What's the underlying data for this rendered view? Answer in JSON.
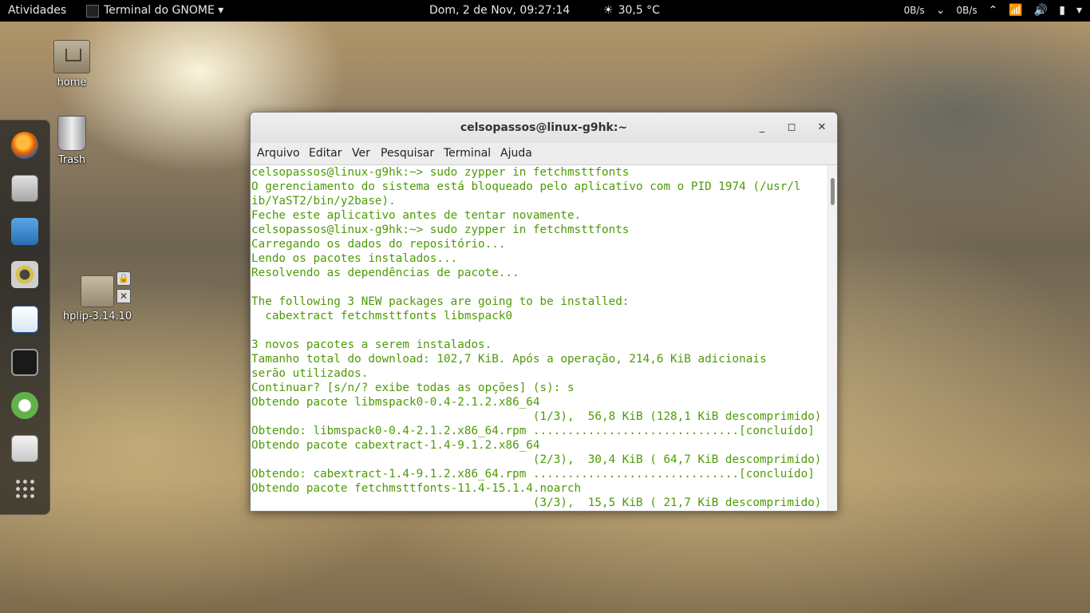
{
  "topbar": {
    "activities": "Atividades",
    "app_menu": "Terminal do GNOME ▾",
    "clock": "Dom,  2 de Nov, 09:27:14",
    "weather": "30,5 °C",
    "net_down": "0B/s",
    "net_up": "0B/s"
  },
  "desktop": {
    "icons": [
      {
        "label": "home"
      },
      {
        "label": "Trash"
      },
      {
        "label": "hplip-3.14.10"
      }
    ]
  },
  "window": {
    "title": "celsopassos@linux-g9hk:~",
    "menu": [
      "Arquivo",
      "Editar",
      "Ver",
      "Pesquisar",
      "Terminal",
      "Ajuda"
    ],
    "terminal_output": "celsopassos@linux-g9hk:~> sudo zypper in fetchmsttfonts\nO gerenciamento do sistema está bloqueado pelo aplicativo com o PID 1974 (/usr/l\nib/YaST2/bin/y2base).\nFeche este aplicativo antes de tentar novamente.\ncelsopassos@linux-g9hk:~> sudo zypper in fetchmsttfonts\nCarregando os dados do repositório...\nLendo os pacotes instalados...\nResolvendo as dependências de pacote...\n\nThe following 3 NEW packages are going to be installed:\n  cabextract fetchmsttfonts libmspack0\n\n3 novos pacotes a serem instalados.\nTamanho total do download: 102,7 KiB. Após a operação, 214,6 KiB adicionais\nserão utilizados.\nContinuar? [s/n/? exibe todas as opções] (s): s\nObtendo pacote libmspack0-0.4-2.1.2.x86_64\n                                         (1/3),  56,8 KiB (128,1 KiB descomprimido)\nObtendo: libmspack0-0.4-2.1.2.x86_64.rpm ..............................[concluído]\nObtendo pacote cabextract-1.4-9.1.2.x86_64\n                                         (2/3),  30,4 KiB ( 64,7 KiB descomprimido)\nObtendo: cabextract-1.4-9.1.2.x86_64.rpm ..............................[concluído]\nObtendo pacote fetchmsttfonts-11.4-15.1.4.noarch\n                                         (3/3),  15,5 KiB ( 21,7 KiB descomprimido)"
  },
  "icons": {
    "weather": "sun-icon",
    "wifi": "wifi-icon",
    "volume": "speaker-icon",
    "battery": "battery-icon"
  }
}
